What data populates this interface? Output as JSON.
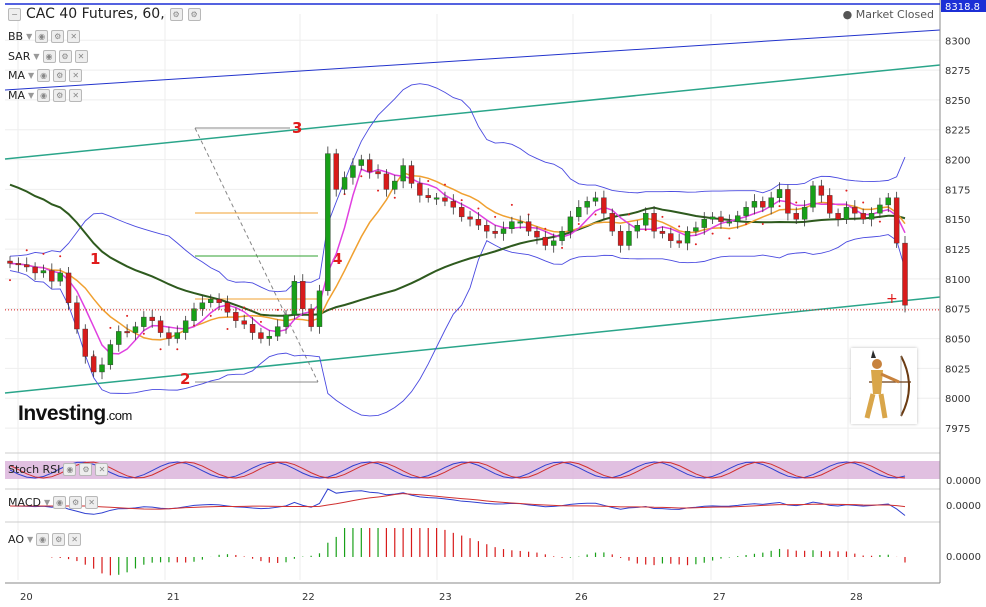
{
  "header": {
    "title": "CAC 40 Futures, 60,",
    "market_status": "Market Closed"
  },
  "indicators_top": [
    "BB",
    "SAR",
    "MA",
    "MA"
  ],
  "panes": [
    "Stoch RSI",
    "MACD",
    "AO"
  ],
  "logo": {
    "main": "Investing",
    "suffix": ".com"
  },
  "wave_labels": [
    "1",
    "2",
    "3",
    "4"
  ],
  "colors": {
    "up": "#18a018",
    "down": "#d81b1b",
    "bb": "#4a4ae0",
    "ma_fast": "#e040e0",
    "ma_mid": "#f0a030",
    "ma_slow": "#2e5a1e",
    "channel": "#2aa58a",
    "chan_blue": "#2233cc",
    "sar": "#e02020"
  },
  "chart_data": {
    "type": "candlestick",
    "x_ticks": [
      "20",
      "21",
      "22",
      "23",
      "26",
      "27",
      "28"
    ],
    "y_ticks": [
      8300,
      8275,
      8250,
      8225,
      8200,
      8175,
      8150,
      8125,
      8100,
      8075,
      8050,
      8025,
      8000,
      7975
    ],
    "ylim": [
      7965,
      8322
    ],
    "last_price": "8318.8",
    "current_price_line": 8074,
    "pane_ticks": {
      "Stoch RSI": "0.0000",
      "MACD": "0.0000",
      "AO": "0.0000"
    },
    "close": [
      8113,
      8112,
      8110,
      8105,
      8107,
      8098,
      8105,
      8080,
      8058,
      8035,
      8022,
      8028,
      8045,
      8056,
      8055,
      8060,
      8068,
      8065,
      8055,
      8050,
      8055,
      8065,
      8075,
      8080,
      8083,
      8080,
      8072,
      8065,
      8062,
      8055,
      8050,
      8052,
      8060,
      8070,
      8098,
      8075,
      8060,
      8090,
      8205,
      8175,
      8185,
      8195,
      8200,
      8190,
      8188,
      8175,
      8182,
      8195,
      8180,
      8170,
      8168,
      8168,
      8165,
      8160,
      8152,
      8150,
      8145,
      8140,
      8138,
      8142,
      8148,
      8148,
      8140,
      8135,
      8128,
      8132,
      8140,
      8152,
      8160,
      8165,
      8168,
      8155,
      8140,
      8128,
      8140,
      8145,
      8155,
      8140,
      8138,
      8132,
      8130,
      8140,
      8143,
      8150,
      8152,
      8148,
      8148,
      8153,
      8160,
      8165,
      8160,
      8168,
      8175,
      8155,
      8150,
      8160,
      8178,
      8170,
      8155,
      8150,
      8160,
      8155,
      8150,
      8155,
      8162,
      8168,
      8130,
      8078
    ]
  }
}
